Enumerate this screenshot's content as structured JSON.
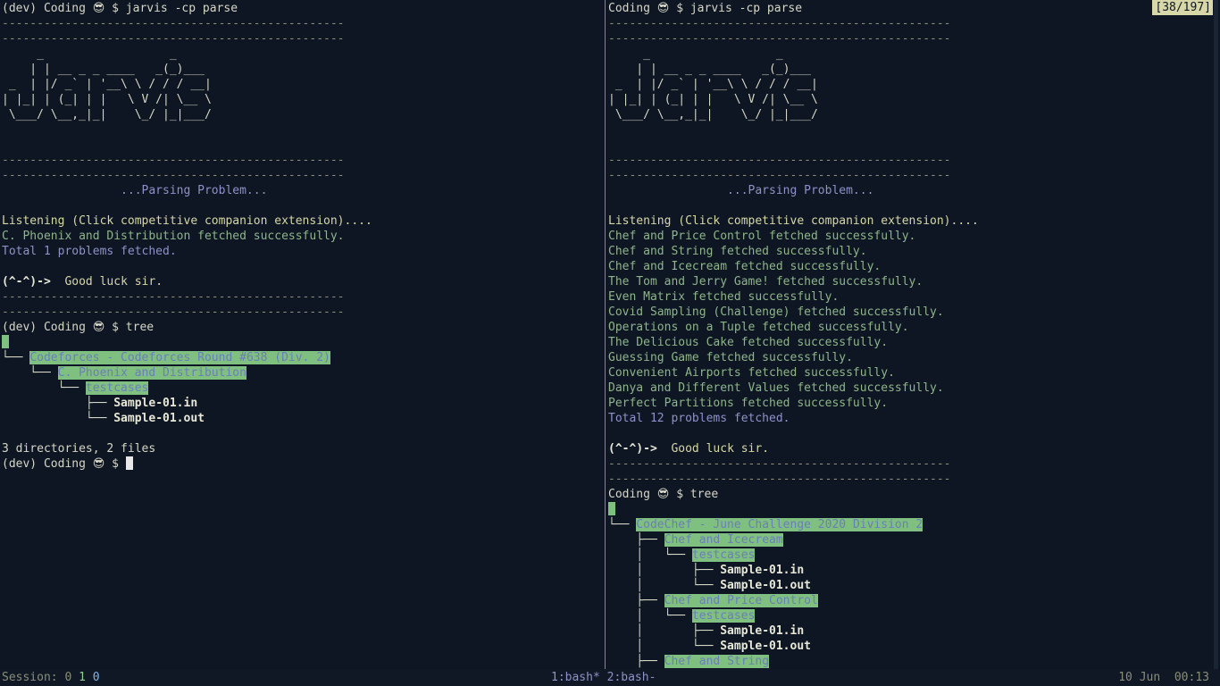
{
  "left": {
    "prompt_env": "(dev) Coding",
    "prompt_emoji": "😎",
    "prompt_symbol": "$",
    "command1": "jarvis -cp parse",
    "dash_line": "-------------------------------------------------",
    "ascii_art": [
      "     _                  _     ",
      "    | | __ _ _ ____   _(_)___ ",
      " _  | |/ _` | '__\\ \\ / / / __|",
      "| |_| | (_| | |   \\ V /| \\__ \\",
      " \\___/ \\__,_|_|    \\_/ |_|___/"
    ],
    "parsing_text": "                 ...Parsing Problem...",
    "listening": "Listening (Click competitive companion extension)....",
    "fetched": [
      "C. Phoenix and Distribution fetched successfully."
    ],
    "total": "Total 1 problems fetched.",
    "luck_face": "(^-^)->",
    "luck_text": "  Good luck sir.",
    "command2": "tree",
    "tree": {
      "root": "Codeforces - Codeforces Round #638 (Div. 2)",
      "problem": "C. Phoenix and Distribution",
      "testcases": "testcases",
      "files": [
        "Sample-01.in",
        "Sample-01.out"
      ]
    },
    "summary": "3 directories, 2 files"
  },
  "right": {
    "prompt_env": "Coding",
    "prompt_emoji": "😎",
    "prompt_symbol": "$",
    "command1": "jarvis -cp parse",
    "counter": "[38/197]",
    "fetched": [
      "Chef and Price Control fetched successfully.",
      "Chef and String fetched successfully.",
      "Chef and Icecream fetched successfully.",
      "The Tom and Jerry Game! fetched successfully.",
      "Even Matrix fetched successfully.",
      "Covid Sampling (Challenge) fetched successfully.",
      "Operations on a Tuple fetched successfully.",
      "The Delicious Cake fetched successfully.",
      "Guessing Game fetched successfully.",
      "Convenient Airports fetched successfully.",
      "Danya and Different Values fetched successfully.",
      "Perfect Partitions fetched successfully."
    ],
    "total": "Total 12 problems fetched.",
    "command2": "tree",
    "tree": {
      "root": "CodeChef - June Challenge 2020 Division 2",
      "problems": [
        {
          "name": "Chef and Icecream",
          "testcases": "testcases",
          "files": [
            "Sample-01.in",
            "Sample-01.out"
          ]
        },
        {
          "name": "Chef and Price Control",
          "testcases": "testcases",
          "files": [
            "Sample-01.in",
            "Sample-01.out"
          ]
        },
        {
          "name": "Chef and String"
        }
      ]
    }
  },
  "status": {
    "session_label": "Session:",
    "session_vals": [
      "0",
      "1",
      "0"
    ],
    "windows": "1:bash* 2:bash-",
    "date": "10 Jun",
    "time": "00:13"
  }
}
